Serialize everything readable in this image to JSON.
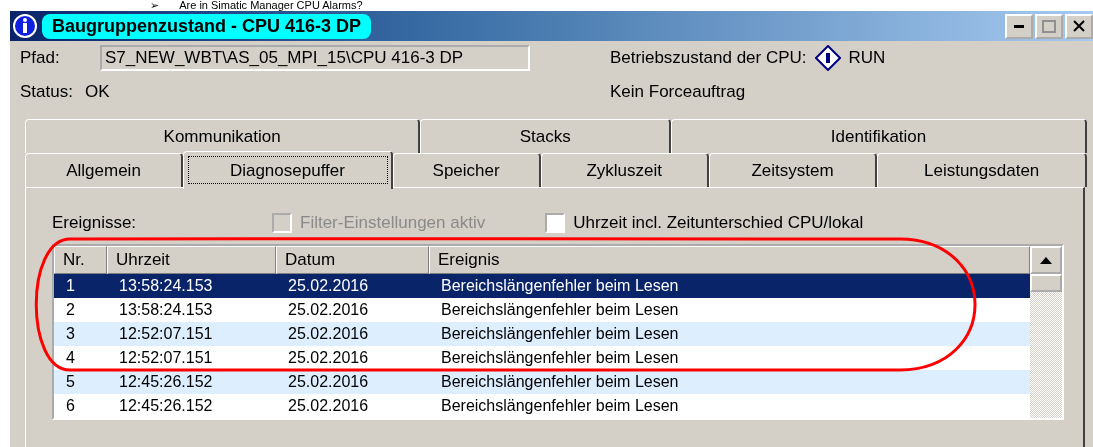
{
  "heading": {
    "bullet": "➢",
    "text": "Are in Simatic Manager CPU Alarms?"
  },
  "window": {
    "title": "Baugruppenzustand - CPU 416-3 DP"
  },
  "path": {
    "label": "Pfad:",
    "value": "S7_NEW_WBT\\AS_05_MPI_15\\CPU 416-3 DP"
  },
  "mode": {
    "label": "Betriebszustand der CPU:",
    "value": "RUN"
  },
  "status": {
    "label": "Status:",
    "value": "OK"
  },
  "force": "Kein Forceauftrag",
  "tab_rows": [
    [
      {
        "label": "Kommunikation",
        "selected": false
      },
      {
        "label": "Stacks",
        "selected": false
      },
      {
        "label": "Identifikation",
        "selected": false
      }
    ],
    [
      {
        "label": "Allgemein",
        "selected": false
      },
      {
        "label": "Diagnosepuffer",
        "selected": true
      },
      {
        "label": "Speicher",
        "selected": false
      },
      {
        "label": "Zykluszeit",
        "selected": false
      },
      {
        "label": "Zeitsystem",
        "selected": false
      },
      {
        "label": "Leistungsdaten",
        "selected": false
      }
    ]
  ],
  "events_label": "Ereignisse:",
  "options": [
    {
      "label": "Filter-Einstellungen aktiv",
      "checked": false,
      "disabled": true
    },
    {
      "label": "Uhrzeit incl. Zeitunterschied CPU/lokal",
      "checked": false,
      "disabled": false
    }
  ],
  "table": {
    "columns": [
      "Nr.",
      "Uhrzeit",
      "Datum",
      "Ereignis"
    ],
    "rows": [
      {
        "cells": [
          "1",
          "13:58:24.153",
          "25.02.2016",
          "Bereichslängenfehler beim Lesen"
        ],
        "selected": true
      },
      {
        "cells": [
          "2",
          "13:58:24.153",
          "25.02.2016",
          "Bereichslängenfehler beim Lesen"
        ],
        "selected": false
      },
      {
        "cells": [
          "3",
          "12:52:07.151",
          "25.02.2016",
          "Bereichslängenfehler beim Lesen"
        ],
        "selected": false
      },
      {
        "cells": [
          "4",
          "12:52:07.151",
          "25.02.2016",
          "Bereichslängenfehler beim Lesen"
        ],
        "selected": false
      },
      {
        "cells": [
          "5",
          "12:45:26.152",
          "25.02.2016",
          "Bereichslängenfehler beim Lesen"
        ],
        "selected": false
      },
      {
        "cells": [
          "6",
          "12:45:26.152",
          "25.02.2016",
          "Bereichslängenfehler beim Lesen"
        ],
        "selected": false
      }
    ]
  }
}
